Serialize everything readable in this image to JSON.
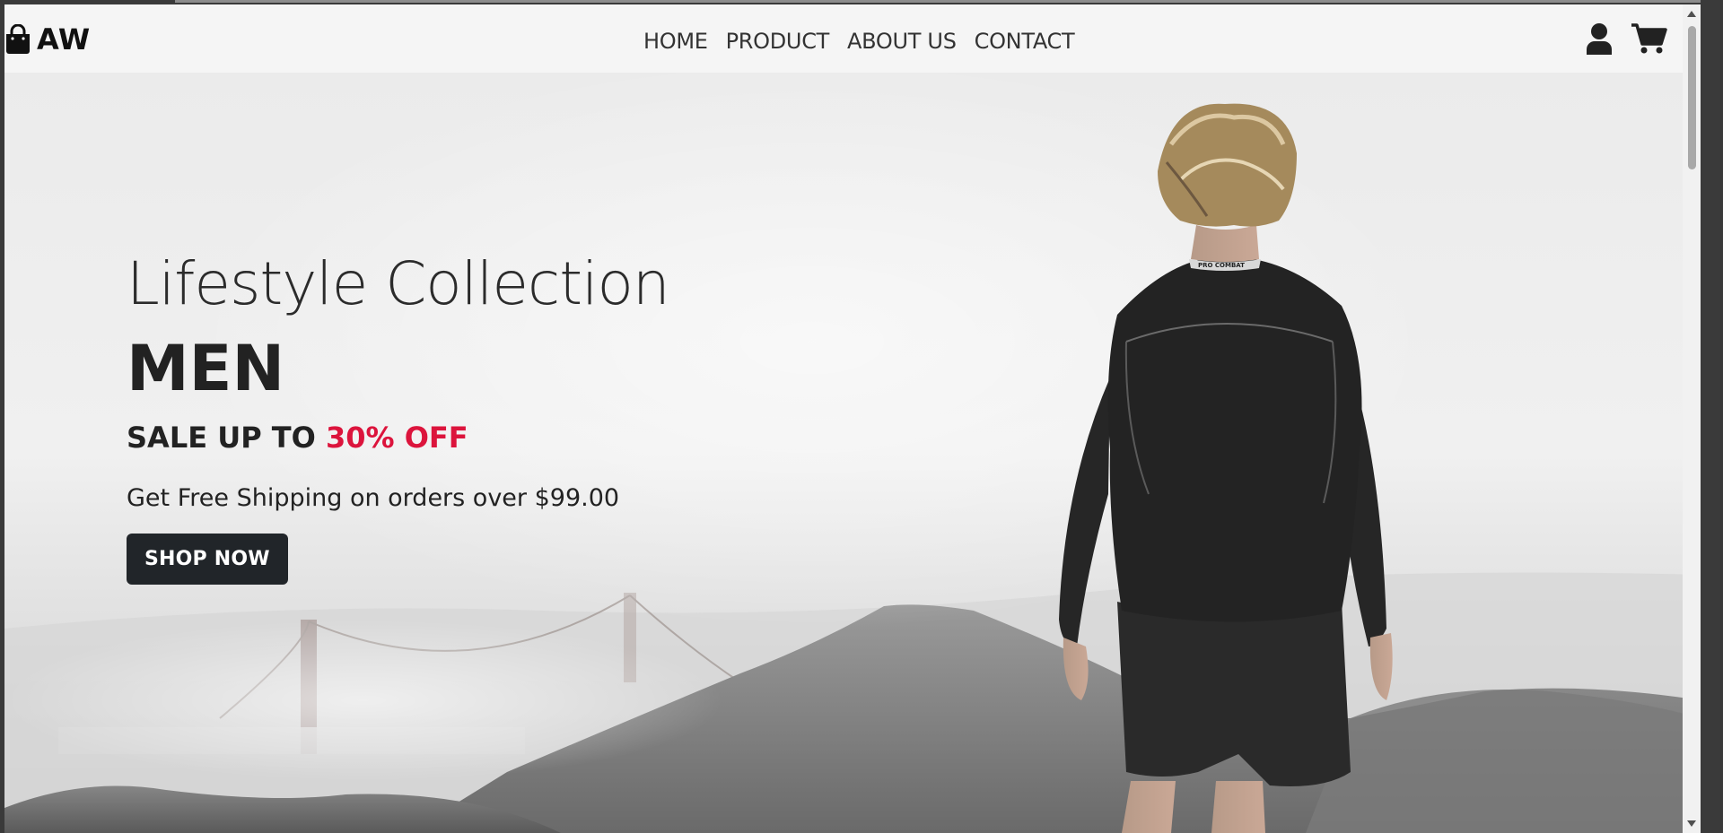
{
  "brand": {
    "name": "AW",
    "icon": "shopping-bag-icon"
  },
  "nav": {
    "items": [
      {
        "label": "HOME"
      },
      {
        "label": "PRODUCT"
      },
      {
        "label": "ABOUT US"
      },
      {
        "label": "CONTACT"
      }
    ]
  },
  "header_icons": {
    "user": "user-icon",
    "cart": "cart-icon"
  },
  "hero": {
    "subtitle": "Lifestyle Collection",
    "title": "MEN",
    "sale_prefix": "SALE UP TO ",
    "sale_highlight": "30% OFF",
    "shipping": "Get Free Shipping on orders over $99.00",
    "button": "SHOP NOW",
    "shirt_print": "PRO COMBAT"
  },
  "colors": {
    "accent": "#dc143c",
    "button_bg": "#212529",
    "navbar_bg": "#f5f5f5",
    "text_dark": "#222222"
  }
}
